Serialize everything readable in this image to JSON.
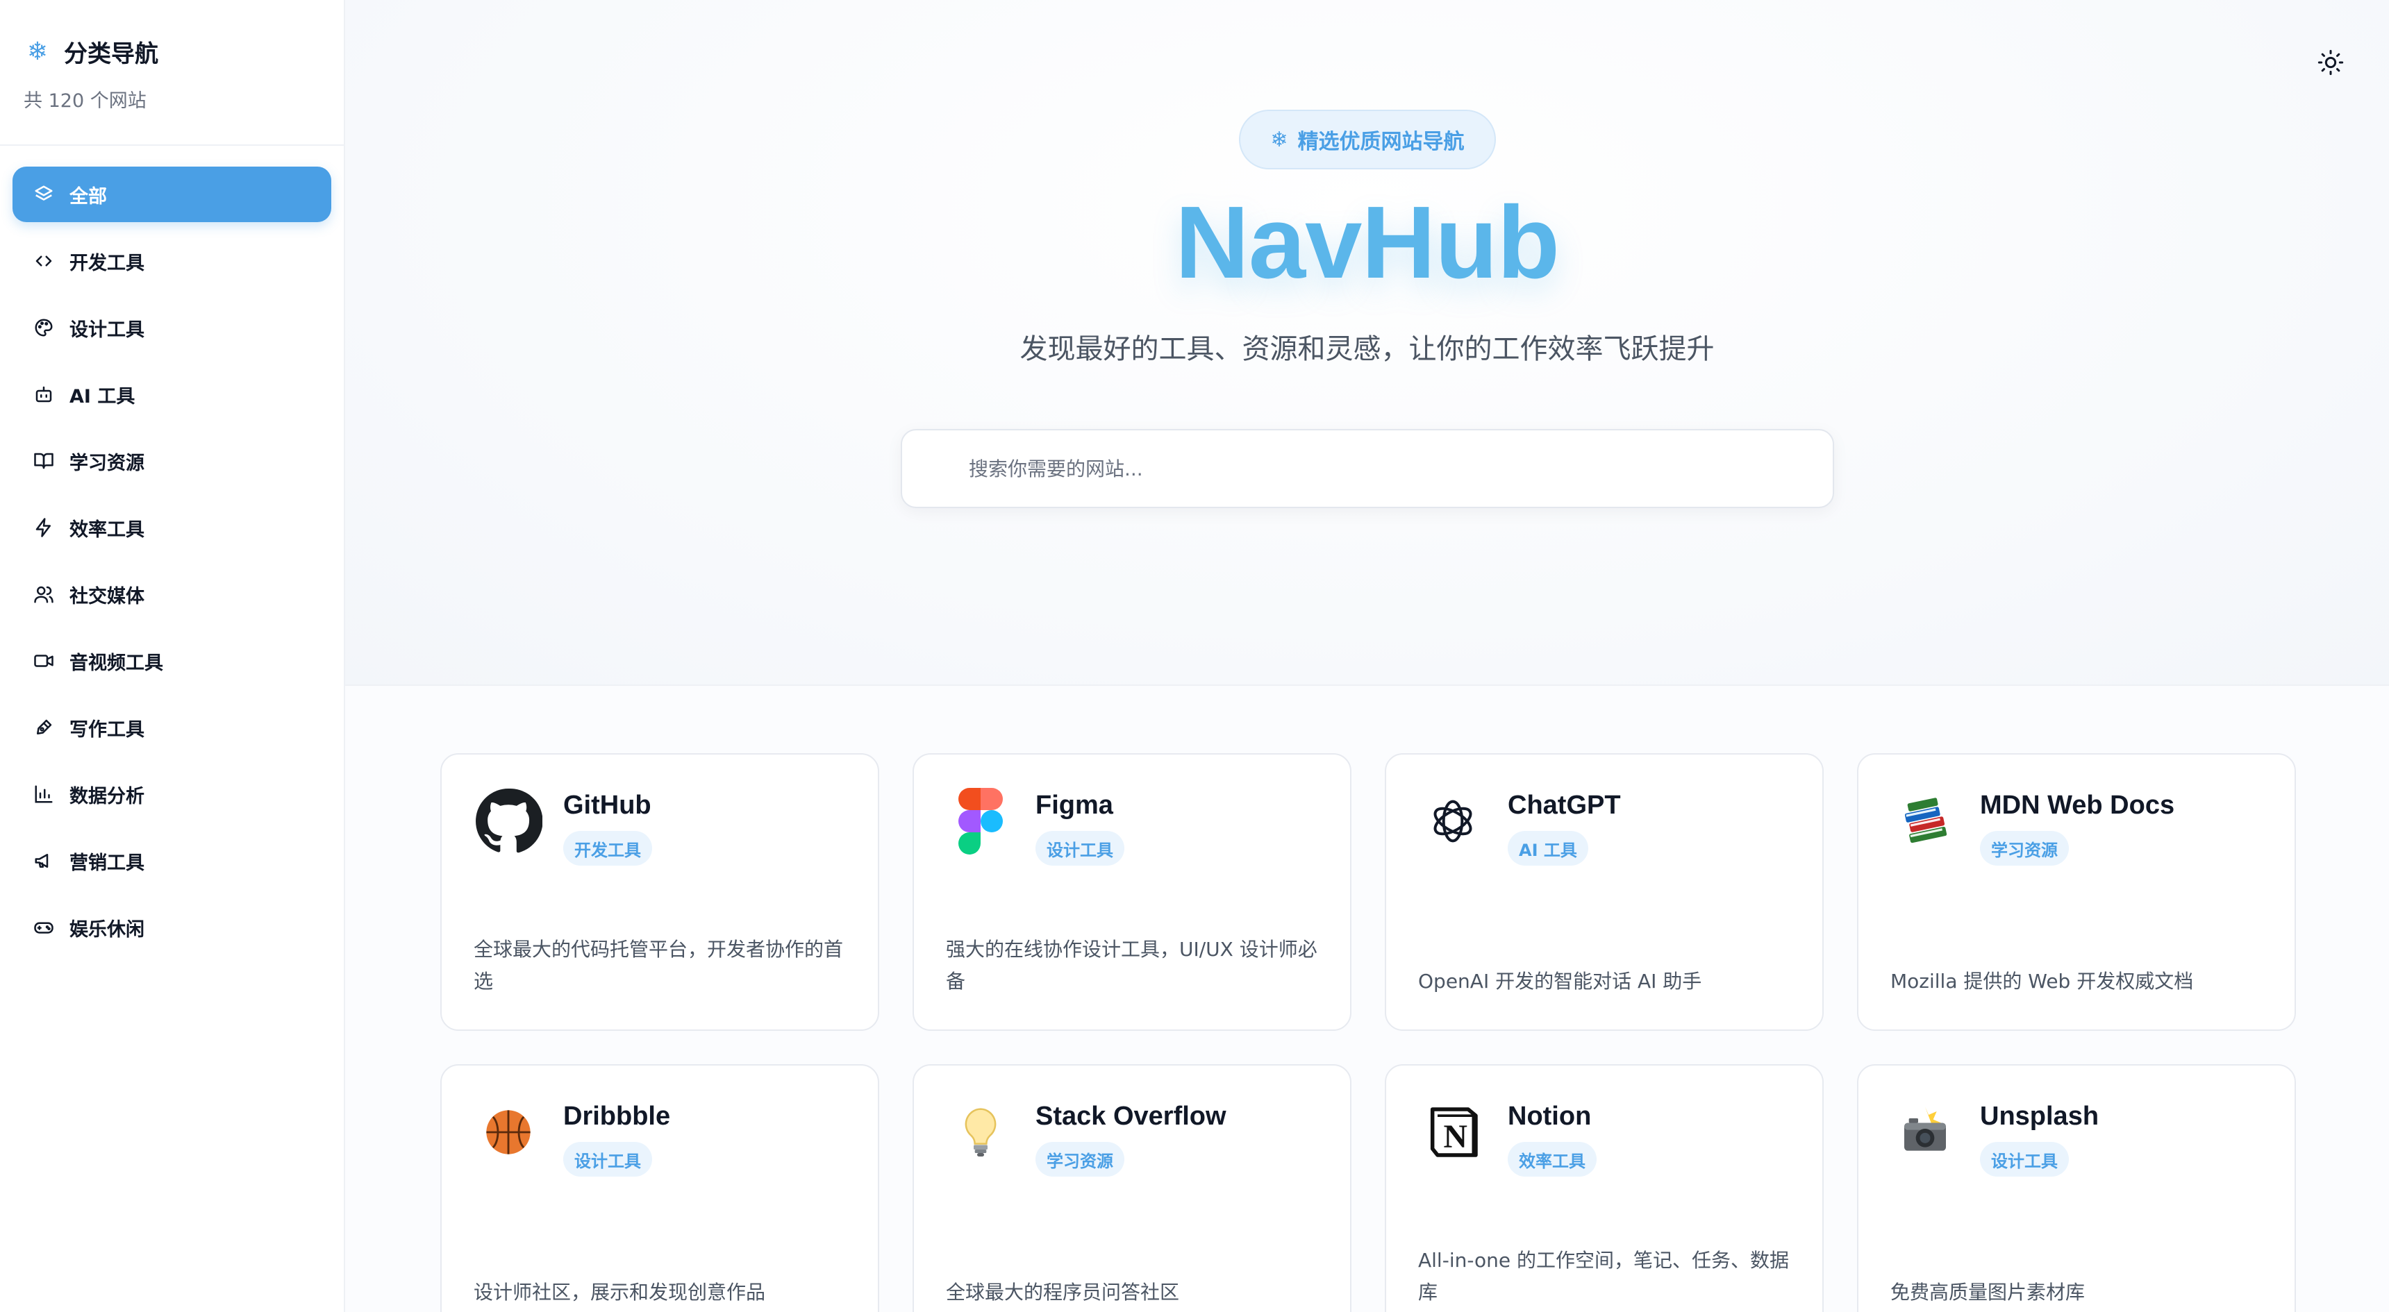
{
  "colors": {
    "accent": "#4a9fe5",
    "title": "#5bb6ea"
  },
  "sidebar": {
    "title": "分类导航",
    "title_icon": "snowflake-icon",
    "count": "共 120 个网站",
    "items": [
      {
        "label": "全部",
        "icon": "layers-icon",
        "active": true
      },
      {
        "label": "开发工具",
        "icon": "code-icon"
      },
      {
        "label": "设计工具",
        "icon": "palette-icon"
      },
      {
        "label": "AI 工具",
        "icon": "bot-icon"
      },
      {
        "label": "学习资源",
        "icon": "book-icon"
      },
      {
        "label": "效率工具",
        "icon": "zap-icon"
      },
      {
        "label": "社交媒体",
        "icon": "users-icon"
      },
      {
        "label": "音视频工具",
        "icon": "video-icon"
      },
      {
        "label": "写作工具",
        "icon": "pen-tool-icon"
      },
      {
        "label": "数据分析",
        "icon": "bar-chart-icon"
      },
      {
        "label": "营销工具",
        "icon": "megaphone-icon"
      },
      {
        "label": "娱乐休闲",
        "icon": "gamepad-icon"
      }
    ]
  },
  "header": {
    "theme_toggle_icon": "sun-icon"
  },
  "hero": {
    "badge": "精选优质网站导航",
    "title": "NavHub",
    "subtitle": "发现最好的工具、资源和灵感，让你的工作效率飞跃提升"
  },
  "search": {
    "placeholder": "搜索你需要的网站...",
    "value": ""
  },
  "cards": [
    {
      "name": "GitHub",
      "tag": "开发工具",
      "desc": "全球最大的代码托管平台，开发者协作的首选",
      "icon": "github-icon"
    },
    {
      "name": "Figma",
      "tag": "设计工具",
      "desc": "强大的在线协作设计工具，UI/UX 设计师必备",
      "icon": "figma-icon"
    },
    {
      "name": "ChatGPT",
      "tag": "AI 工具",
      "desc": "OpenAI 开发的智能对话 AI 助手",
      "icon": "openai-icon"
    },
    {
      "name": "MDN Web Docs",
      "tag": "学习资源",
      "desc": "Mozilla 提供的 Web 开发权威文档",
      "icon": "books-icon"
    },
    {
      "name": "Dribbble",
      "tag": "设计工具",
      "desc": "设计师社区，展示和发现创意作品",
      "icon": "basketball-icon"
    },
    {
      "name": "Stack Overflow",
      "tag": "学习资源",
      "desc": "全球最大的程序员问答社区",
      "icon": "lightbulb-icon"
    },
    {
      "name": "Notion",
      "tag": "效率工具",
      "desc": "All-in-one 的工作空间，笔记、任务、数据库",
      "icon": "notion-icon"
    },
    {
      "name": "Unsplash",
      "tag": "设计工具",
      "desc": "免费高质量图片素材库",
      "icon": "camera-flash-icon"
    }
  ]
}
